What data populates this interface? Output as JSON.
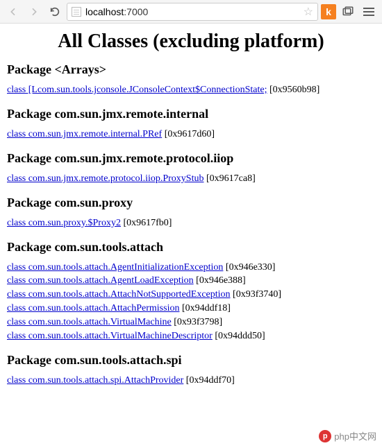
{
  "toolbar": {
    "url_host": "localhost",
    "url_port": ":7000",
    "ext_label": "k"
  },
  "page": {
    "title": "All Classes (excluding platform)"
  },
  "packages": [
    {
      "name": "Package <Arrays>",
      "classes": [
        {
          "link": "class [Lcom.sun.tools.jconsole.JConsoleContext$ConnectionState;",
          "addr": "[0x9560b98]"
        }
      ]
    },
    {
      "name": "Package com.sun.jmx.remote.internal",
      "classes": [
        {
          "link": "class com.sun.jmx.remote.internal.PRef",
          "addr": "[0x9617d60]"
        }
      ]
    },
    {
      "name": "Package com.sun.jmx.remote.protocol.iiop",
      "classes": [
        {
          "link": "class com.sun.jmx.remote.protocol.iiop.ProxyStub",
          "addr": "[0x9617ca8]"
        }
      ]
    },
    {
      "name": "Package com.sun.proxy",
      "classes": [
        {
          "link": "class com.sun.proxy.$Proxy2",
          "addr": "[0x9617fb0]"
        }
      ]
    },
    {
      "name": "Package com.sun.tools.attach",
      "classes": [
        {
          "link": "class com.sun.tools.attach.AgentInitializationException",
          "addr": "[0x946e330]"
        },
        {
          "link": "class com.sun.tools.attach.AgentLoadException",
          "addr": "[0x946e388]"
        },
        {
          "link": "class com.sun.tools.attach.AttachNotSupportedException",
          "addr": "[0x93f3740]"
        },
        {
          "link": "class com.sun.tools.attach.AttachPermission",
          "addr": "[0x94ddf18]"
        },
        {
          "link": "class com.sun.tools.attach.VirtualMachine",
          "addr": "[0x93f3798]"
        },
        {
          "link": "class com.sun.tools.attach.VirtualMachineDescriptor",
          "addr": "[0x94ddd50]"
        }
      ]
    },
    {
      "name": "Package com.sun.tools.attach.spi",
      "classes": [
        {
          "link": "class com.sun.tools.attach.spi.AttachProvider",
          "addr": "[0x94ddf70]"
        }
      ]
    }
  ],
  "watermark": {
    "badge": "p",
    "text": "php中文网"
  }
}
